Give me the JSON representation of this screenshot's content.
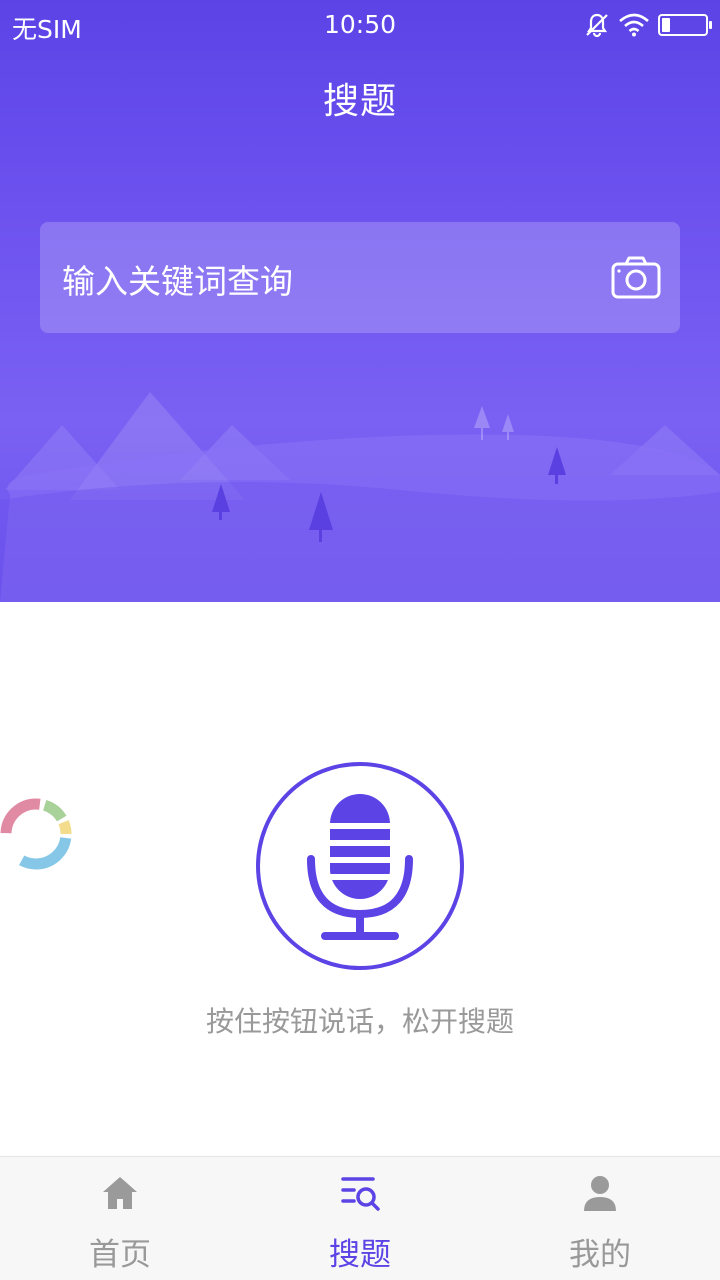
{
  "status_bar": {
    "carrier": "无SIM",
    "time": "10:50",
    "icons": [
      "mute-icon",
      "wifi-icon",
      "battery-icon"
    ]
  },
  "header": {
    "title": "搜题"
  },
  "search": {
    "placeholder": "输入关键词查询",
    "camera_icon": "camera-icon"
  },
  "voice": {
    "mic_icon": "microphone-icon",
    "hint": "按住按钮说话，松开搜题"
  },
  "tab_bar": {
    "items": [
      {
        "label": "首页",
        "icon": "home-icon",
        "active": false
      },
      {
        "label": "搜题",
        "icon": "search-list-icon",
        "active": true
      },
      {
        "label": "我的",
        "icon": "user-icon",
        "active": false
      }
    ]
  },
  "colors": {
    "primary": "#5b43e6",
    "header_light": "#7a61f3",
    "inactive_tab": "#999999",
    "hint_text": "#999999",
    "tab_bar_bg": "#f7f7f7"
  }
}
